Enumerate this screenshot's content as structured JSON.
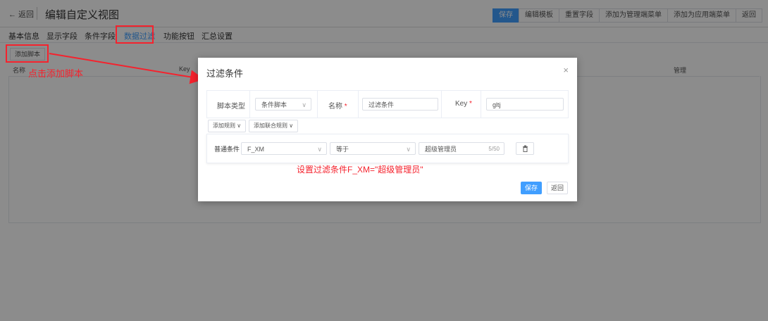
{
  "header": {
    "back_label": "← 返回",
    "title": "编辑自定义视图",
    "buttons": [
      "保存",
      "编辑模板",
      "重置字段",
      "添加为管理端菜单",
      "添加为应用端菜单",
      "返回"
    ]
  },
  "tabs": [
    "基本信息",
    "显示字段",
    "条件字段",
    "数据过滤",
    "功能按钮",
    "汇总设置"
  ],
  "active_tab": "数据过滤",
  "toolbar": {
    "add_script": "添加脚本"
  },
  "table": {
    "headers": [
      "名称",
      "Key",
      "管理"
    ]
  },
  "annotations": {
    "add_script_hint": "点击添加脚本",
    "filter_hint": "设置过滤条件F_XM=\"超级管理员\""
  },
  "dialog": {
    "title": "过滤条件",
    "close": "×",
    "script_type_label": "脚本类型",
    "script_type_value": "条件脚本",
    "name_label": "名称",
    "name_value": "过滤条件",
    "key_label": "Key",
    "key_value": "gltj",
    "required_mark": "*",
    "add_rule": "添加规则 ∨",
    "add_combined_rule": "添加联合规则 ∨",
    "rule": {
      "label": "普通条件",
      "field": "F_XM",
      "operator": "等于",
      "value": "超级管理员",
      "count": "5/50",
      "delete_icon": "trash-icon"
    },
    "save": "保存",
    "return": "返回"
  },
  "colors": {
    "primary": "#409eff",
    "annotation": "#f5222d"
  }
}
